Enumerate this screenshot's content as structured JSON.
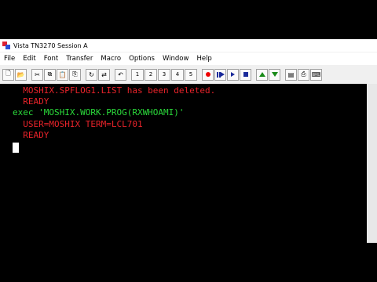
{
  "window": {
    "title": "Vista TN3270 Session A"
  },
  "menu": [
    "File",
    "Edit",
    "Font",
    "Transfer",
    "Macro",
    "Options",
    "Window",
    "Help"
  ],
  "toolbar": {
    "buttons": [
      {
        "name": "new-icon",
        "glyph": "🗋"
      },
      {
        "name": "open-icon",
        "glyph": "📂"
      },
      {
        "name": "save-icon",
        "glyph": "💾"
      },
      {
        "name": "cut-icon",
        "glyph": "✂"
      },
      {
        "name": "copy-icon",
        "glyph": "⧉"
      },
      {
        "name": "paste-icon",
        "glyph": "📋"
      },
      {
        "name": "copy-append-icon",
        "glyph": "⎘"
      },
      {
        "name": "refresh-icon",
        "glyph": "↻"
      },
      {
        "name": "transfer-icon",
        "glyph": "⇄"
      },
      {
        "name": "undo-icon",
        "glyph": "↶"
      }
    ],
    "pf_keys": [
      "1",
      "2",
      "3",
      "4",
      "5"
    ]
  },
  "terminal": {
    "lines": [
      {
        "text": "  MOSHIX.SPFLOG1.LIST has been deleted.",
        "color": "red"
      },
      {
        "text": "  READY",
        "color": "red"
      },
      {
        "text": "exec 'MOSHIX.WORK.PROG(RXWHOAMI)'",
        "color": "green"
      },
      {
        "text": "  USER=MOSHIX TERM=LCL701",
        "color": "red"
      },
      {
        "text": "  READY",
        "color": "red"
      }
    ]
  },
  "colors": {
    "background": "#000000",
    "output": "#e8232a",
    "input": "#2ad93a",
    "cursor": "#ffffff"
  }
}
